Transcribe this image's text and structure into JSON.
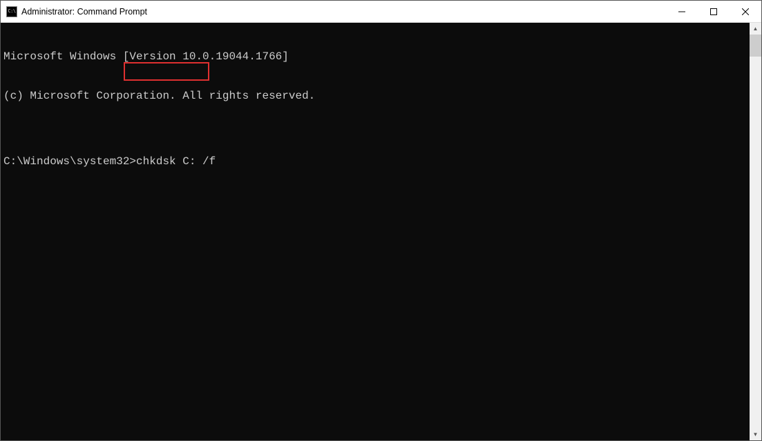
{
  "window": {
    "title": "Administrator: Command Prompt",
    "icon_text": "C:\\"
  },
  "terminal": {
    "line1": "Microsoft Windows [Version 10.0.19044.1766]",
    "line2": "(c) Microsoft Corporation. All rights reserved.",
    "blank": "",
    "prompt": "C:\\Windows\\system32>",
    "command": "chkdsk C: /f"
  },
  "scrollbar": {
    "up": "▲",
    "down": "▼"
  }
}
